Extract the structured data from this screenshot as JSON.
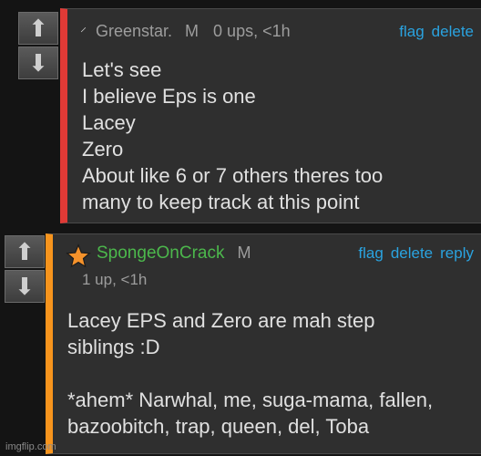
{
  "comments": [
    {
      "username": "Greenstar.",
      "badge": "M",
      "meta": "0 ups, <1h",
      "actions": [
        "flag",
        "delete"
      ],
      "lines": [
        "Let's see",
        "I believe Eps is one",
        "Lacey",
        "Zero",
        "About like 6 or 7 others theres too",
        "many to keep track at this point"
      ],
      "accent_color": "#e03a36"
    },
    {
      "username": "SpongeOnCrack",
      "badge": "M",
      "meta": "1 up, <1h",
      "actions": [
        "flag",
        "delete",
        "reply"
      ],
      "lines": [
        "Lacey EPS and Zero are mah step",
        "siblings :D",
        "",
        "*ahem* Narwhal, me, suga-mama, fallen,",
        "bazoobitch, trap, queen, del, Toba"
      ],
      "accent_color": "#f7941d"
    }
  ],
  "vote_icons": {
    "up": "arrow-up-icon",
    "down": "arrow-down-icon"
  },
  "user_icon": "star-icon",
  "watermark": "imgflip.com"
}
